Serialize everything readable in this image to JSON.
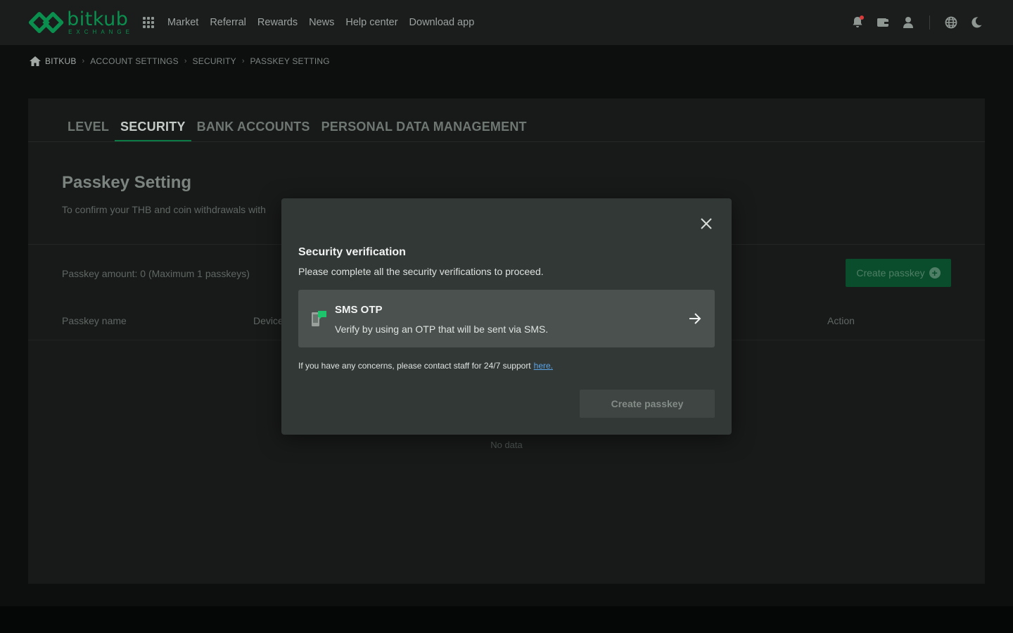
{
  "brand": {
    "name": "bitkub",
    "sub": "EXCHANGE",
    "color": "#0b8f4e"
  },
  "nav": {
    "items": [
      "Market",
      "Referral",
      "Rewards",
      "News",
      "Help center",
      "Download app"
    ]
  },
  "breadcrumb": [
    "BITKUB",
    "ACCOUNT SETTINGS",
    "SECURITY",
    "PASSKEY SETTING"
  ],
  "tabs": [
    {
      "label": "LEVEL",
      "active": false
    },
    {
      "label": "SECURITY",
      "active": true
    },
    {
      "label": "BANK ACCOUNTS",
      "active": false
    },
    {
      "label": "PERSONAL DATA MANAGEMENT",
      "active": false
    }
  ],
  "page": {
    "title": "Passkey Setting",
    "description": "To confirm your THB and coin withdrawals with",
    "amount": "Passkey amount: 0 (Maximum 1 passkeys)",
    "create_button": "Create passkey",
    "columns": {
      "name": "Passkey name",
      "device": "Device",
      "action": "Action"
    },
    "no_data": "No data"
  },
  "modal": {
    "title": "Security verification",
    "description": "Please complete all the security verifications to proceed.",
    "option": {
      "title": "SMS OTP",
      "description": "Verify by using an OTP that will be sent via SMS.",
      "icon": "phone-message-icon"
    },
    "help_text": "If you have any concerns, please contact staff for 24/7 support",
    "help_link": "here.",
    "submit_button": "Create passkey"
  },
  "colors": {
    "accent": "#0b7a44",
    "notification": "#d93a3a",
    "link": "#5aa4e8"
  }
}
